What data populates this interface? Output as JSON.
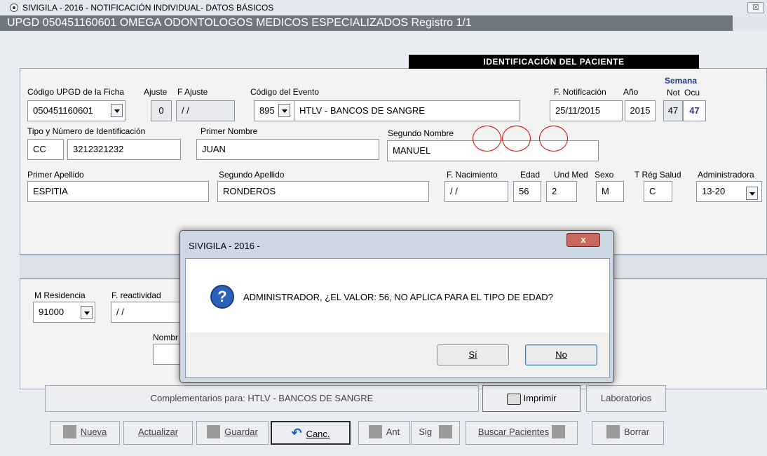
{
  "window": {
    "title": "SIVIGILA - 2016 -  NOTIFICACIÓN INDIVIDUAL- DATOS BÁSICOS",
    "close_glyph": "☒",
    "header": "UPGD 050451160601 OMEGA ODONTOLOGOS MEDICOS ESPECIALIZADOS Registro 1/1"
  },
  "section": {
    "title": "IDENTIFICACIÓN DEL PACIENTE"
  },
  "fields": {
    "codigo_upgd": {
      "label": "Código UPGD de la Ficha",
      "value": "050451160601"
    },
    "ajuste": {
      "label": "Ajuste",
      "value": "0"
    },
    "f_ajuste": {
      "label": "F Ajuste",
      "value": "/ /"
    },
    "codigo_evento": {
      "label": "Código del Evento",
      "value": "895",
      "name": "HTLV - BANCOS DE SANGRE"
    },
    "f_notificacion": {
      "label": "F. Notificación",
      "value": "25/11/2015"
    },
    "anio": {
      "label": "Año",
      "value": "2015"
    },
    "semana": {
      "label": "Semana",
      "not_label": "Not",
      "ocu_label": "Ocu",
      "not_value": "47",
      "ocu_value": "47"
    },
    "tipo_id": {
      "label": "Tipo y Número de Identificación",
      "tipo": "CC",
      "numero": "3212321232"
    },
    "primer_nombre": {
      "label": "Primer Nombre",
      "value": "JUAN"
    },
    "segundo_nombre": {
      "label": "Segundo Nombre",
      "value": "MANUEL"
    },
    "primer_apellido": {
      "label": "Primer Apellido",
      "value": "ESPITIA"
    },
    "segundo_apellido": {
      "label": "Segundo Apellido",
      "value": "RONDEROS"
    },
    "f_nacimiento": {
      "label": "F. Nacimiento",
      "value": "/ /"
    },
    "edad": {
      "label": "Edad",
      "value": "56"
    },
    "und_med": {
      "label": "Und Med",
      "value": "2"
    },
    "sexo": {
      "label": "Sexo",
      "value": "M"
    },
    "t_reg_salud": {
      "label": "T Rég Salud",
      "value": "C"
    },
    "administradora": {
      "label": "Administradora",
      "value": "13-20"
    },
    "m_residencia": {
      "label": "M Residencia",
      "value": "91000"
    },
    "f_reactividad": {
      "label": "F. reactividad",
      "value": "/ /"
    },
    "nombre_partial": {
      "label": "Nombr"
    }
  },
  "buttons": {
    "complementarios": {
      "label_prefix": "Complementarios para: HTLV - BANCOS DE SANGRE"
    },
    "imprimir": {
      "label": "Imprimir"
    },
    "laboratorios": {
      "label": "Laboratorios"
    },
    "nueva": {
      "label": "Nueva"
    },
    "actualizar": {
      "label": "Actualizar"
    },
    "guardar": {
      "label": "Guardar"
    },
    "canc": {
      "label": "Canc."
    },
    "ant": {
      "label": "Ant"
    },
    "sig": {
      "label": "Sig"
    },
    "buscar": {
      "label": "Buscar Pacientes"
    },
    "borrar": {
      "label": "Borrar"
    }
  },
  "dialog": {
    "title": "SIVIGILA - 2016 -",
    "close_glyph": "x",
    "icon_glyph": "?",
    "message": "ADMINISTRADOR, ¿EL VALOR: 56, NO APLICA PARA EL TIPO DE EDAD?",
    "yes_label": "Sí",
    "no_label": "No"
  },
  "colors": {
    "header_bar": "#6e7781",
    "form_bg": "#e9ecf1",
    "section_bar": "#000000",
    "annotation_circles": "#e00000",
    "semana_text": "#1f3a93"
  }
}
